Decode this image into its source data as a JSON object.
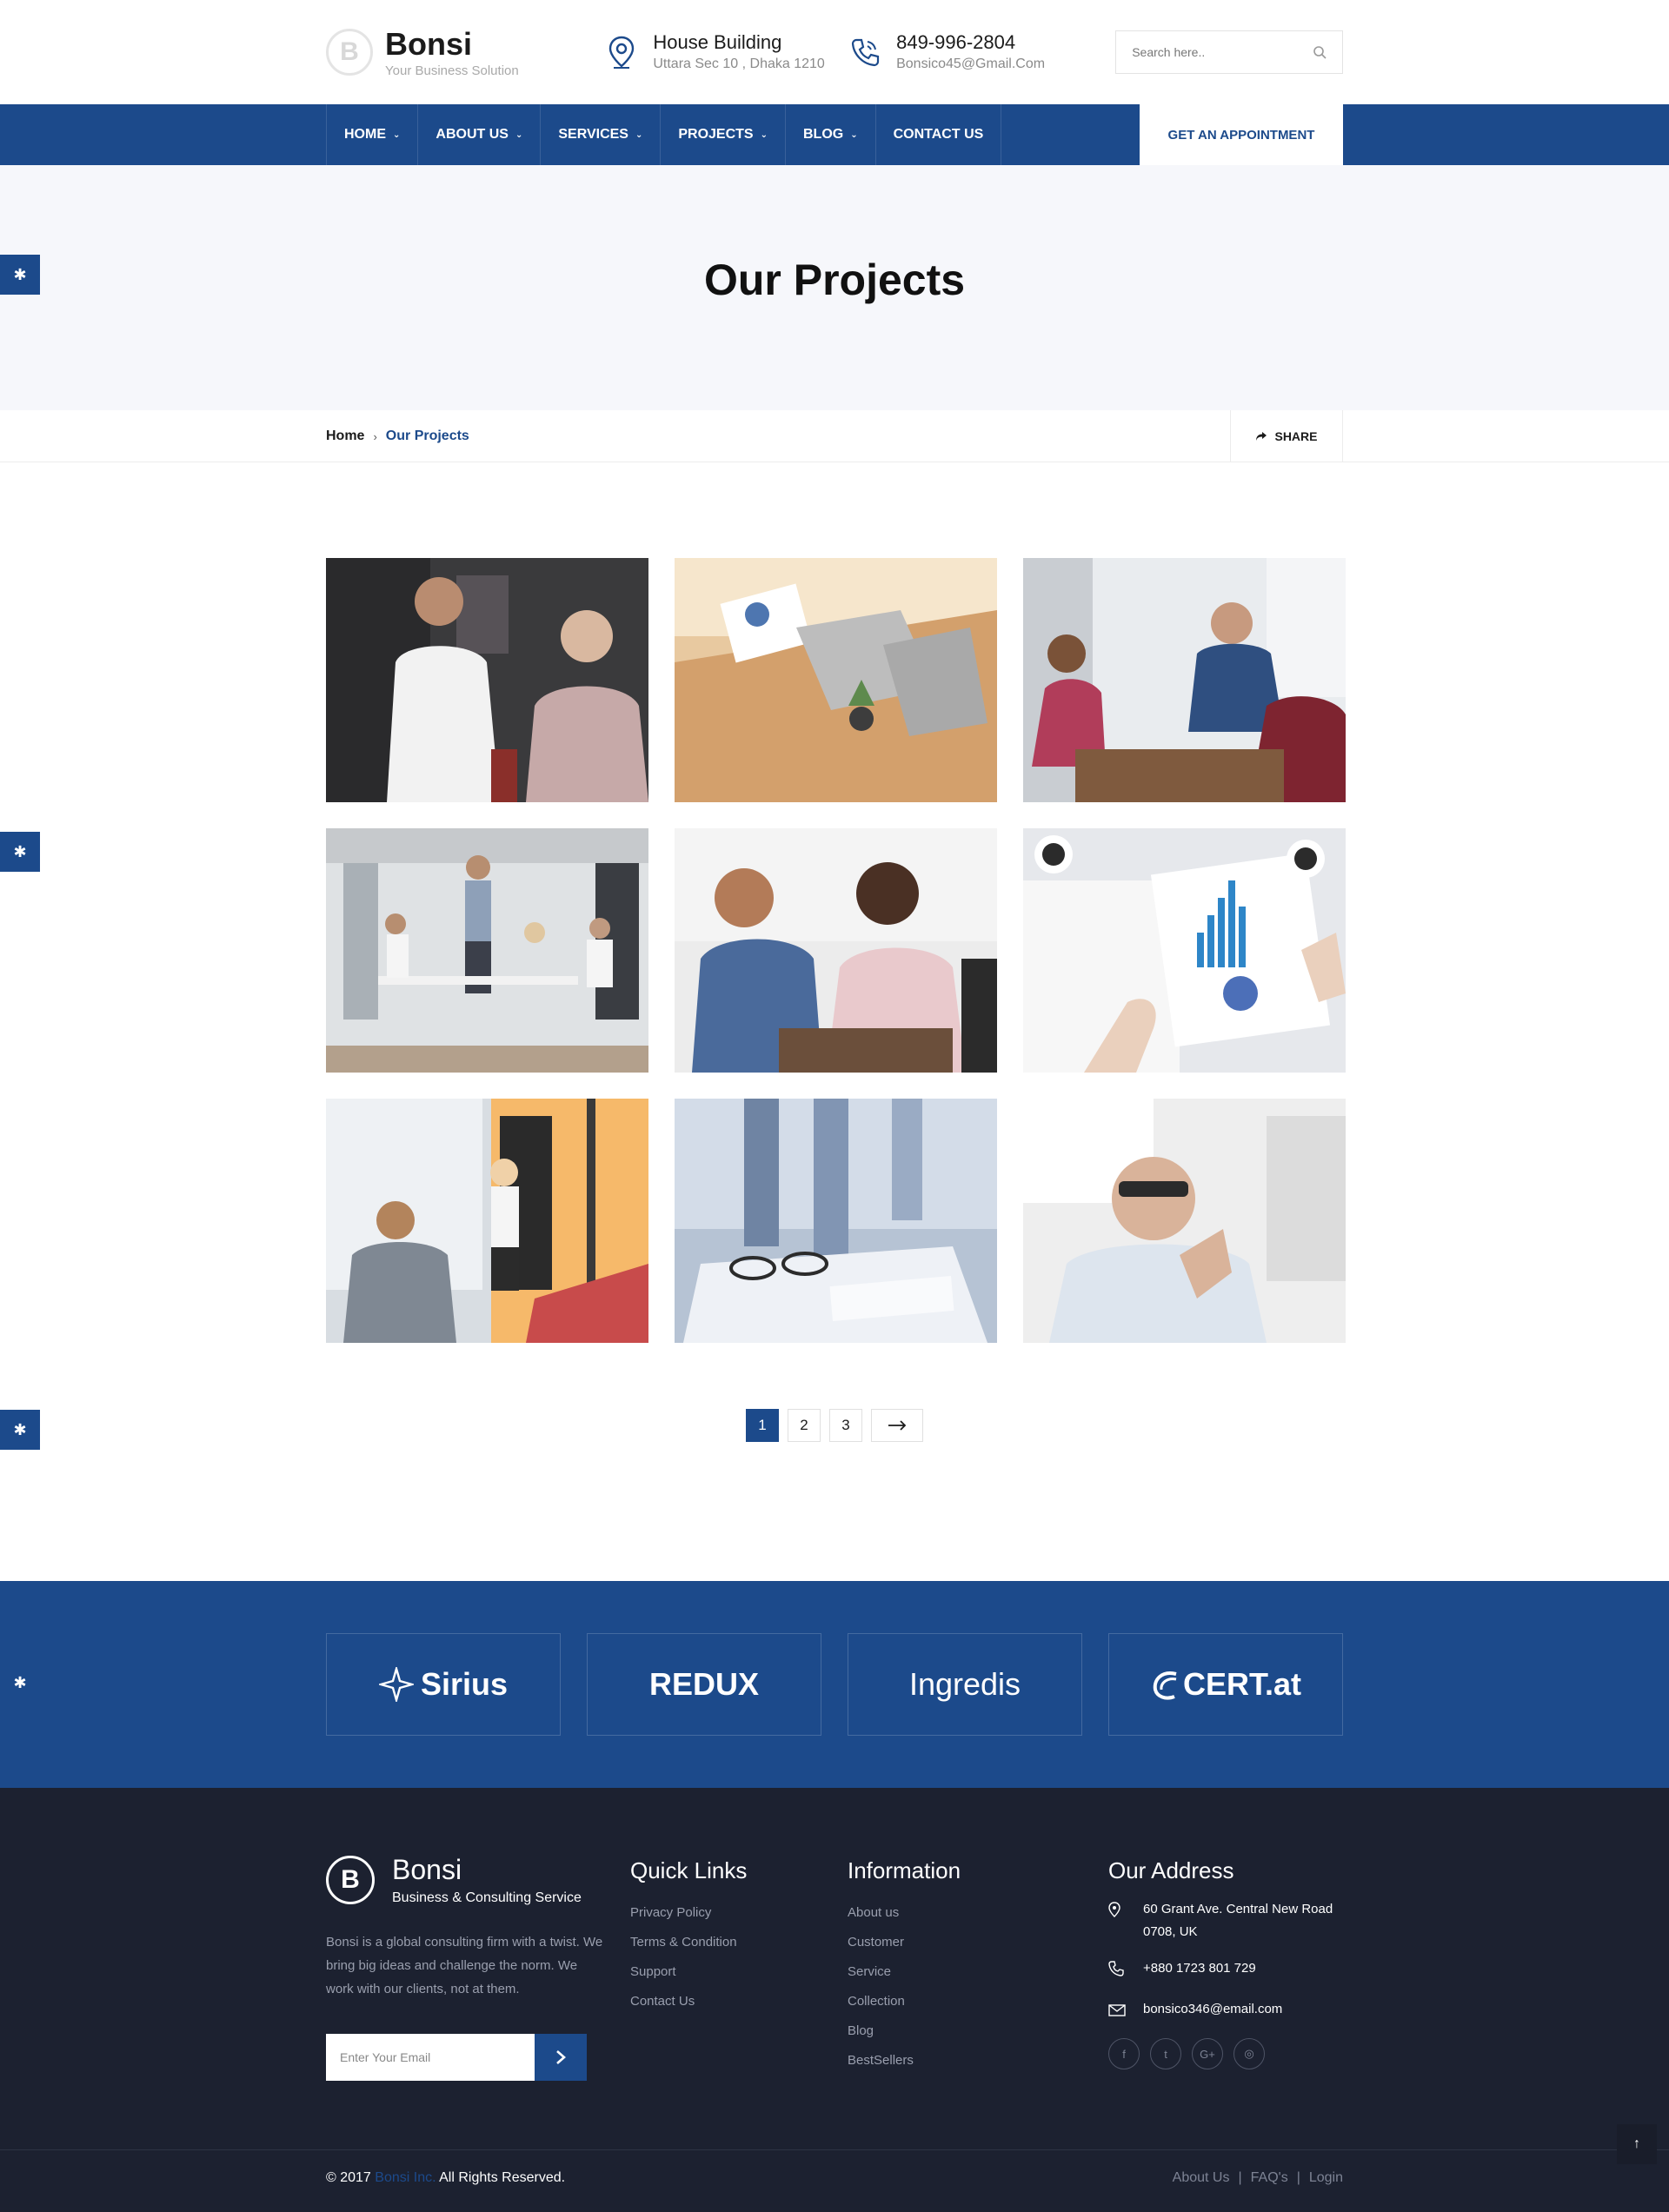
{
  "brand": {
    "mark": "B",
    "name": "Bonsi",
    "tagline": "Your Business Solution"
  },
  "header": {
    "address_title": "House Building",
    "address_sub": "Uttara Sec 10 , Dhaka 1210",
    "phone_title": "849-996-2804",
    "phone_sub": "Bonsico45@Gmail.Com",
    "search_placeholder": "Search here.."
  },
  "nav": {
    "items": [
      {
        "label": "HOME"
      },
      {
        "label": "ABOUT US"
      },
      {
        "label": "SERVICES"
      },
      {
        "label": "PROJECTS"
      },
      {
        "label": "BLOG"
      },
      {
        "label": "CONTACT US"
      }
    ],
    "appointment": "GET AN APPOINTMENT"
  },
  "banner": {
    "title": "Our Projects"
  },
  "breadcrumb": {
    "home": "Home",
    "separator": "›",
    "current": "Our Projects",
    "share": "SHARE"
  },
  "gallery": {
    "tiles": [
      {
        "icon": "two-men-office-photo"
      },
      {
        "icon": "laptop-desk-photo"
      },
      {
        "icon": "team-meeting-photo"
      },
      {
        "icon": "office-presentation-photo"
      },
      {
        "icon": "coworkers-talking-photo"
      },
      {
        "icon": "charts-paperwork-photo"
      },
      {
        "icon": "whiteboard-presentation-photo"
      },
      {
        "icon": "glasses-documents-photo"
      },
      {
        "icon": "thoughtful-man-photo"
      }
    ]
  },
  "pagination": {
    "pages": [
      "1",
      "2",
      "3"
    ],
    "active": "1",
    "next_icon": "arrow-right-icon"
  },
  "partners": [
    "Sirius",
    "REDUX",
    "Ingredis",
    "CERT.at"
  ],
  "footer": {
    "mark": "B",
    "name": "Bonsi",
    "tagline": "Business & Consulting Service",
    "description": "Bonsi is a global consulting firm with a twist. We bring big ideas and challenge the norm. We work with our clients, not at them.",
    "email_placeholder": "Enter Your Email",
    "quick_links_title": "Quick Links",
    "quick_links": [
      "Privacy Policy",
      "Terms & Condition",
      "Support",
      "Contact Us"
    ],
    "information_title": "Information",
    "information": [
      "About us",
      "Customer",
      "Service",
      "Collection",
      "Blog",
      "BestSellers"
    ],
    "address_title": "Our Address",
    "address": "60 Grant Ave. Central New Road 0708, UK",
    "phone": "+880 1723 801 729",
    "email": "bonsico346@email.com",
    "socials": [
      "f",
      "t",
      "G+",
      "◎"
    ]
  },
  "bottom": {
    "copyright_prefix": "© 2017",
    "copyright_brand": "Bonsi Inc.",
    "copyright_suffix": "All Rights Reserved.",
    "links": [
      "About Us",
      "FAQ's",
      "Login"
    ],
    "to_top": "↑"
  },
  "colors": {
    "primary": "#1c4a8b",
    "footer_bg": "#1c2130",
    "banner_bg": "#f6f7fb"
  }
}
